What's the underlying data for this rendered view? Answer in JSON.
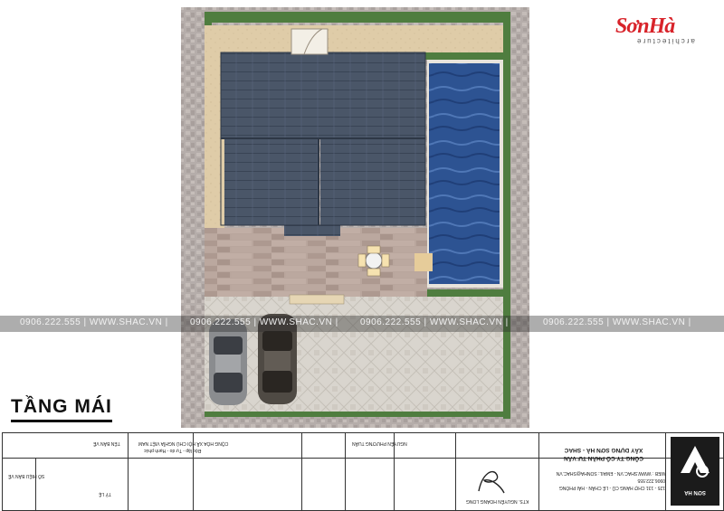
{
  "drawing_title": "TẦNG MÁI",
  "logo": {
    "brand": "SơnHà",
    "tagline": "architecture"
  },
  "watermark": {
    "text": "0906.222.555 | WWW.SHAC.VN |"
  },
  "title_block": {
    "company_name_1": "CÔNG TY CỔ PHẦN TƯ VẤN",
    "company_name_2": "XÂY DỰNG SƠN HÀ - SHAC",
    "address": "125 - 131 CHỢ HÀNG CŨ - LÊ CHÂN - HẢI PHÒNG",
    "phone": "0906.222.555",
    "web_email": "WEB : WWW.SHAC.VN - EMAIL: SONHA@SHAC.VN",
    "logo_caption": "SƠN HÀ",
    "architect": "KTS. NGUYỄN HOÀNG LONG",
    "designer": "NGUYỄN PHƯƠNG TUẤN",
    "country": "CỘNG HÒA XÃ HỘI CHỦ NGHĨA VIỆT NAM",
    "motto": "Độc lập - Tự do - Hạnh phúc",
    "drawing_name_label": "TÊN BẢN VẼ",
    "scale": "TỶ LỆ",
    "sheet": "SỐ HIỆU BẢN VẼ"
  },
  "colors": {
    "roof": "#4a5667",
    "pool": "#2a4a8a",
    "deck": "#b7a39a",
    "grass": "#4f7d3f",
    "paver": "#d8d4cc",
    "border": "#b2aaa6"
  }
}
